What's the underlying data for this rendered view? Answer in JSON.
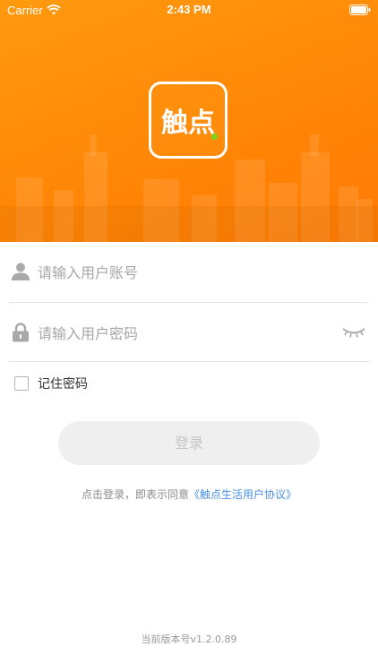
{
  "status_bar": {
    "carrier": "Carrier",
    "time": "2:43 PM"
  },
  "brand": {
    "logo_text": "触点",
    "accent_color": "#ff8a08",
    "dot_color": "#7ed321"
  },
  "form": {
    "username_placeholder": "请输入用户账号",
    "password_placeholder": "请输入用户密码",
    "remember_label": "记住密码",
    "login_label": "登录"
  },
  "agreement": {
    "prefix": "点击登录，即表示同意",
    "link": "《触点生活用户协议》"
  },
  "footer": {
    "version": "当前版本号v1.2.0.89"
  },
  "icons": {
    "username": "user-icon",
    "password": "lock-icon",
    "toggle_visibility": "eye-closed-icon"
  }
}
